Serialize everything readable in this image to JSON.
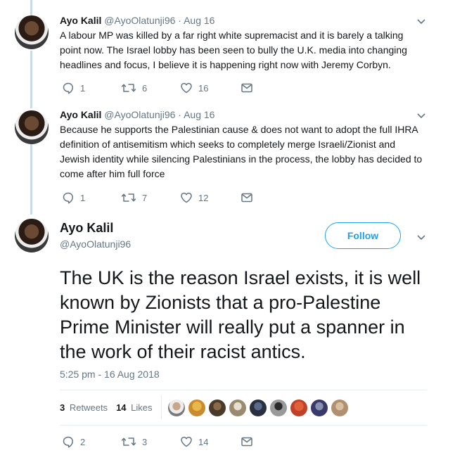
{
  "tweets": [
    {
      "name": "Ayo Kalil",
      "handle": "@AyoOlatunji96",
      "date": "· Aug 16",
      "text": "A labour MP was killed by a far right white supremacist and it is barely a talking point now. The Israel lobby has been seen to bully the U.K. media into changing headlines and focus, I believe it is happening right now with Jeremy Corbyn.",
      "replies": "1",
      "retweets": "6",
      "likes": "16"
    },
    {
      "name": "Ayo Kalil",
      "handle": "@AyoOlatunji96",
      "date": "· Aug 16",
      "text": "Because he supports the Palestinian cause & does not want to adopt the full IHRA definition of antisemitism which seeks to completely merge Israeli/Zionist and Jewish identity while silencing Palestinians in the process, the lobby has decided to come after him full force",
      "replies": "1",
      "retweets": "7",
      "likes": "12"
    }
  ],
  "main": {
    "name": "Ayo Kalil",
    "handle": "@AyoOlatunji96",
    "follow_label": "Follow",
    "text": "The UK is the reason Israel exists, it is well known by Zionists that a pro-Palestine Prime Minister will really put a spanner in the work of their racist antics.",
    "timestamp": "5:25 pm - 16 Aug 2018",
    "retweet_count": "3",
    "retweet_label": "Retweets",
    "like_count": "14",
    "like_label": "Likes",
    "replies": "2",
    "retweets": "3",
    "likes": "14"
  },
  "colors": {
    "accent": "#1da1f2",
    "thread_line": "#b8e0f7",
    "muted": "#657786"
  },
  "icons": [
    "reply-icon",
    "retweet-icon",
    "like-icon",
    "dm-icon",
    "chevron-down-icon"
  ]
}
